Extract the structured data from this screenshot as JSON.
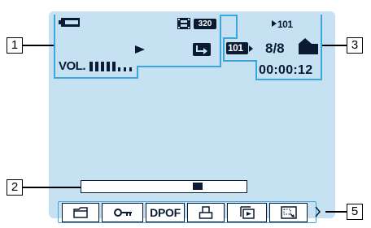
{
  "callouts": [
    "1",
    "2",
    "3",
    "5"
  ],
  "overlay": {
    "resolution_label": "320",
    "volume_label": "VOL.",
    "volume_level": 0.5,
    "folder_number": "101",
    "image_count": "8/8",
    "counter": "00:00:12",
    "playback_progress": 0.72
  },
  "toolbar": {
    "dpof_label": "DPOF"
  },
  "icons": {
    "battery": "battery-icon",
    "film": "film-icon",
    "play": "play-icon",
    "return": "return-icon",
    "folder": "folder-icon",
    "key": "protect-key-icon",
    "print": "print-icon",
    "slideshow": "slideshow-icon",
    "resize": "resize-icon",
    "next": "chevron-right-icon"
  },
  "colors": {
    "screen": "#c6e2f2",
    "frame_line": "#3aa6dd",
    "foreground": "#0a1a33"
  }
}
